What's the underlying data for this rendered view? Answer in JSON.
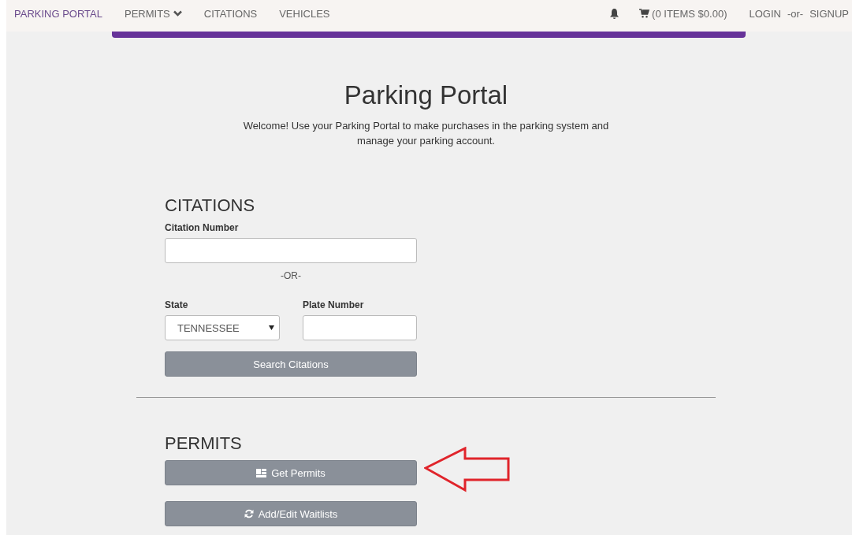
{
  "navbar": {
    "brand": "PARKING PORTAL",
    "items": [
      {
        "label": "PERMITS",
        "kind": "dropdown"
      },
      {
        "label": "CITATIONS",
        "kind": "link"
      },
      {
        "label": "VEHICLES",
        "kind": "link"
      }
    ],
    "cart": "(0 ITEMS $0.00)",
    "login": "LOGIN",
    "separator": "-or-",
    "signup": "SIGNUP"
  },
  "hero": {
    "title": "Parking Portal",
    "text": "Welcome! Use your Parking Portal to make purchases in the parking system and manage your parking account."
  },
  "citations": {
    "heading": "CITATIONS",
    "citation_label": "Citation Number",
    "or": "-OR-",
    "state_label": "State",
    "state_value": "TENNESSEE",
    "plate_label": "Plate Number",
    "button": "Search Citations"
  },
  "permits": {
    "heading": "PERMITS",
    "buttons": [
      {
        "label": "Get Permits",
        "kind": "grid",
        "highlighted": true
      },
      {
        "label": "Add/Edit Waitlists",
        "kind": "refresh",
        "highlighted": false
      }
    ]
  }
}
